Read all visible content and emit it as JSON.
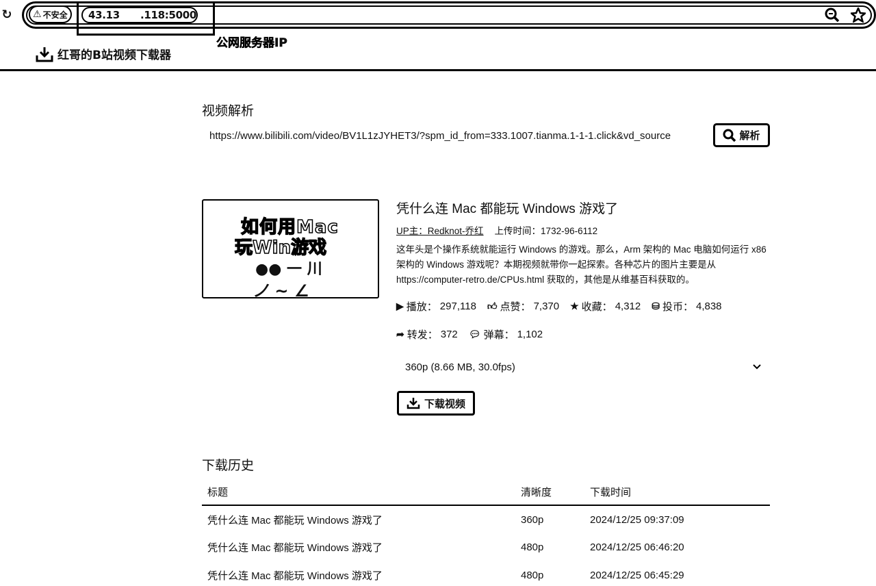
{
  "browser": {
    "insecure_label": "不安全",
    "url_start": "43.13",
    "url_end": ".118:5000",
    "ip_annotation": "公网服务器IP",
    "bookmark_label": "红哥的B站视频下载器"
  },
  "parse_section": {
    "title": "视频解析",
    "url_value": "https://www.bilibili.com/video/BV1L1zJYHET3/?spm_id_from=333.1007.tianma.1-1-1.click&vd_source",
    "button_label": "解析"
  },
  "video": {
    "thumbnail_lines": [
      "如何用Mac",
      "玩Win游戏",
      "●● 一 川",
      "ノ ~ ∠"
    ],
    "title": "凭什么连 Mac 都能玩 Windows 游戏了",
    "uploader": "UP主：Redknot-乔红",
    "upload_time": "上传时间：1732-96-6112",
    "description": "这年头是个操作系统就能运行 Windows 的游戏。那么，Arm 架构的 Mac 电脑如何运行 x86 架构的 Windows 游戏呢？本期视频就带你一起探索。各种芯片的图片主要是从 https://computer-retro.de/CPUs.html 获取的，其他是从维基百科获取的。",
    "stats": {
      "play_label": "播放：",
      "play": "297,118",
      "like_label": "点赞：",
      "like": "7,370",
      "fav_label": "收藏：",
      "fav": "4,312",
      "coin_label": "投币：",
      "coin": "4,838",
      "share_label": "转发：",
      "share": "372",
      "danmaku_label": "弹幕：",
      "danmaku": "1,102"
    },
    "quality_selected": "360p (8.66 MB, 30.0fps)",
    "download_label": "下载视频"
  },
  "history": {
    "title": "下载历史",
    "headers": [
      "标题",
      "清晰度",
      "下载时间"
    ],
    "rows": [
      [
        "凭什么连 Mac 都能玩 Windows 游戏了",
        "360p",
        "2024/12/25 09:37:09"
      ],
      [
        "凭什么连 Mac 都能玩 Windows 游戏了",
        "480p",
        "2024/12/25 06:46:20"
      ],
      [
        "凭什么连 Mac 都能玩 Windows 游戏了",
        "480p",
        "2024/12/25 06:45:29"
      ]
    ]
  }
}
